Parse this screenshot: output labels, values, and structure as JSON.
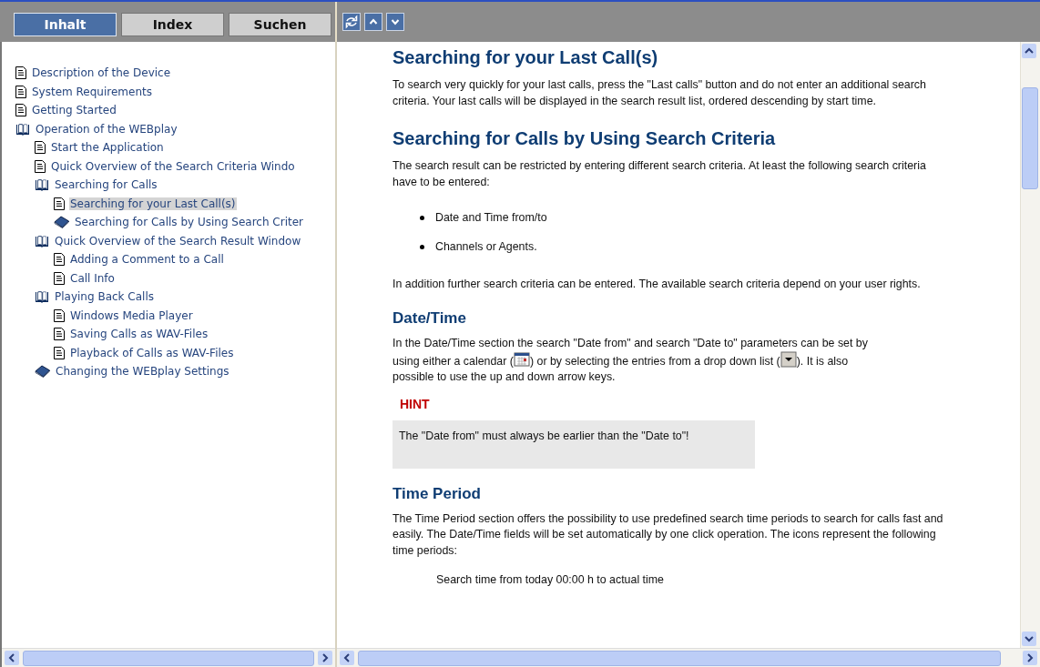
{
  "tabs": [
    {
      "label": "Inhalt",
      "selected": true
    },
    {
      "label": "Index",
      "selected": false
    },
    {
      "label": "Suchen",
      "selected": false
    }
  ],
  "toc": [
    {
      "kind": "page",
      "label": "Description of the Device",
      "selected": false
    },
    {
      "kind": "page",
      "label": "System Requirements",
      "selected": false
    },
    {
      "kind": "page",
      "label": "Getting Started",
      "selected": false
    },
    {
      "kind": "book_open",
      "label": "Operation of the WEBplay",
      "selected": false,
      "children": [
        {
          "kind": "page",
          "label": "Start the Application",
          "selected": false
        },
        {
          "kind": "page",
          "label": "Quick Overview of the Search Criteria Windo",
          "selected": false
        },
        {
          "kind": "book_open",
          "label": "Searching for Calls",
          "selected": false,
          "children": [
            {
              "kind": "page",
              "label": "Searching for your Last Call(s)",
              "selected": true
            },
            {
              "kind": "book_closed",
              "label": "Searching for Calls by Using Search Criter",
              "selected": false
            }
          ]
        },
        {
          "kind": "book_open",
          "label": "Quick Overview of the Search Result Window",
          "selected": false,
          "children": [
            {
              "kind": "page",
              "label": "Adding a Comment to a Call",
              "selected": false
            },
            {
              "kind": "page",
              "label": "Call Info",
              "selected": false
            }
          ]
        },
        {
          "kind": "book_open",
          "label": "Playing Back Calls",
          "selected": false,
          "children": [
            {
              "kind": "page",
              "label": "Windows Media Player",
              "selected": false
            },
            {
              "kind": "page",
              "label": "Saving Calls as WAV-Files",
              "selected": false
            },
            {
              "kind": "page",
              "label": "Playback of Calls as WAV-Files",
              "selected": false
            }
          ]
        },
        {
          "kind": "book_closed",
          "label": "Changing the WEBplay Settings",
          "selected": false
        }
      ]
    }
  ],
  "content": [
    {
      "kind": "h1",
      "text": "Searching for your Last Call(s)"
    },
    {
      "kind": "p",
      "text": "To search very quickly for your last calls, press the \"Last calls\" button and do not enter an additional search criteria. Your last calls will be displayed in the search result list, ordered descending by start time."
    },
    {
      "kind": "h1",
      "text": "Searching for Calls by Using Search Criteria"
    },
    {
      "kind": "p",
      "text": "The search result can be restricted by entering different search criteria. At least the following search criteria have to be entered:"
    },
    {
      "kind": "bullets",
      "items": [
        "Date and Time from/to",
        "Channels or Agents."
      ]
    },
    {
      "kind": "p",
      "text": "In addition further search criteria can be entered. The available search criteria depend on your user rights."
    },
    {
      "kind": "h2",
      "text": "Date/Time"
    },
    {
      "kind": "p_icons",
      "lines": [
        [
          {
            "text": "In the Date/Time section the search \"Date from\" and search \"Date to\" parameters can be set by"
          }
        ],
        [
          {
            "text": "using either a calendar ("
          },
          {
            "kind": "calendar"
          },
          {
            "text": ") or by selecting the entries from a drop down list ("
          },
          {
            "kind": "dropdown"
          },
          {
            "text": "). It is also"
          }
        ],
        [
          {
            "text": "possible to use the up and down arrow keys."
          }
        ]
      ]
    },
    {
      "kind": "hint",
      "title": "HINT",
      "text": "The \"Date from\" must always be earlier than the \"Date to\"!"
    },
    {
      "kind": "h2",
      "text": "Time Period"
    },
    {
      "kind": "p",
      "text": "The Time Period section offers the possibility to use predefined search time periods to search for calls fast and easily. The Date/Time fields will be set automatically by one click operation. The icons represent the following time periods:"
    },
    {
      "kind": "indent",
      "text": "Search time from today 00:00 h to actual time"
    }
  ]
}
